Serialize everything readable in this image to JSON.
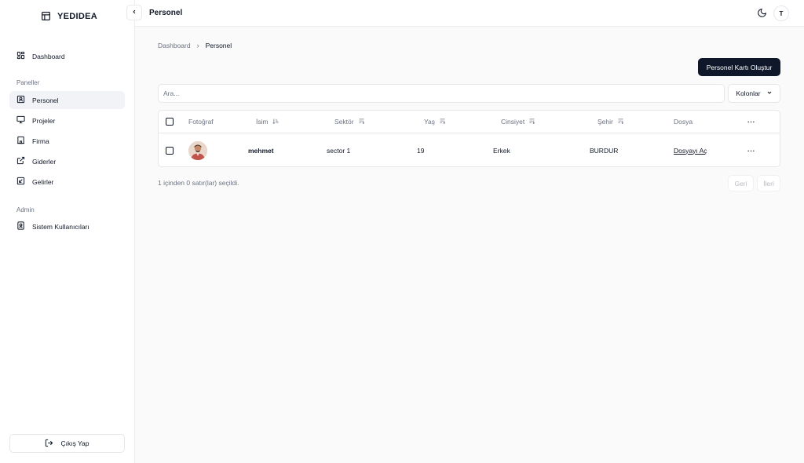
{
  "brand": {
    "name": "YEDIDEA"
  },
  "sidebar": {
    "dashboard": {
      "label": "Dashboard"
    },
    "panels_label": "Paneller",
    "panels": [
      {
        "label": "Personel",
        "icon": "id-card-icon",
        "active": true
      },
      {
        "label": "Projeler",
        "icon": "presentation-icon",
        "active": false
      },
      {
        "label": "Firma",
        "icon": "building-icon",
        "active": false
      },
      {
        "label": "Giderler",
        "icon": "external-link-icon",
        "active": false
      },
      {
        "label": "Gelirler",
        "icon": "arrow-down-left-icon",
        "active": false
      }
    ],
    "admin_label": "Admin",
    "admin": [
      {
        "label": "Sistem Kullanıcıları",
        "icon": "user-square-icon"
      }
    ],
    "logout_label": "Çıkış Yap"
  },
  "header": {
    "title": "Personel",
    "avatar_initial": "T"
  },
  "breadcrumb": {
    "items": [
      "Dashboard",
      "Personel"
    ],
    "separator": "›"
  },
  "actions": {
    "create_label": "Personel Kartı Oluştur",
    "search_placeholder": "Ara...",
    "columns_label": "Kolonlar"
  },
  "table": {
    "columns": [
      "Fotoğraf",
      "İsim",
      "Sektör",
      "Yaş",
      "Cinsiyet",
      "Şehir",
      "Dosya"
    ],
    "more_label": "···",
    "rows": [
      {
        "name": "mehmet",
        "sector": "sector 1",
        "age": "19",
        "gender": "Erkek",
        "city": "BURDUR",
        "file_link": "Dosyayı Aç",
        "more_label": "···"
      }
    ]
  },
  "footer": {
    "selection_text": "1 içinden 0 satır(lar) seçildi.",
    "prev_label": "Geri",
    "next_label": "İleri"
  },
  "colors": {
    "primary": "#0f172a",
    "active_bg": "#f1f3f7",
    "border": "#e5e7eb",
    "muted_text": "#6b7280"
  }
}
